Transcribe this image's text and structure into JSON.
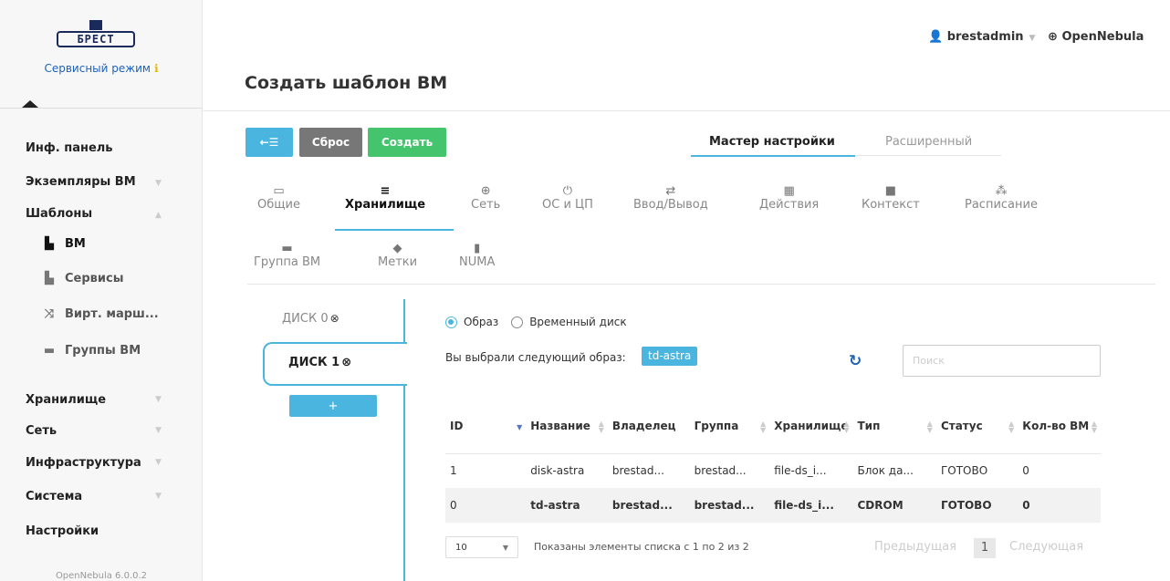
{
  "sidebar": {
    "logo_text": "БРЕСТ",
    "service_mode": "Сервисный режим",
    "menu": [
      {
        "label": "Инф. панель"
      },
      {
        "label": "Экземпляры ВМ"
      },
      {
        "label": "Шаблоны"
      },
      {
        "label": "Хранилище"
      },
      {
        "label": "Сеть"
      },
      {
        "label": "Инфраструктура"
      },
      {
        "label": "Система"
      },
      {
        "label": "Настройки"
      }
    ],
    "submenu": [
      {
        "label": "ВМ",
        "icon": "file-icon"
      },
      {
        "label": "Сервисы",
        "icon": "files-icon"
      },
      {
        "label": "Вирт. марш...",
        "icon": "random-icon"
      },
      {
        "label": "Группы ВМ",
        "icon": "folder-open-icon"
      }
    ],
    "version": "OpenNebula 6.0.0.2"
  },
  "topbar": {
    "user": "brestadmin",
    "zone": "OpenNebula"
  },
  "page": {
    "title": "Создать шаблон ВМ"
  },
  "toolbar": {
    "back_label": "←☰",
    "reset_label": "Сброс",
    "create_label": "Создать"
  },
  "modes": {
    "wizard": "Мастер настройки",
    "advanced": "Расширенный"
  },
  "wizard_tabs": [
    {
      "label": "Общие",
      "glyph": "▭"
    },
    {
      "label": "Хранилище",
      "glyph": "≡"
    },
    {
      "label": "Сеть",
      "glyph": "⊕"
    },
    {
      "label": "ОС и ЦП",
      "glyph": "⏻"
    },
    {
      "label": "Ввод/Вывод",
      "glyph": "⇄"
    },
    {
      "label": "Действия",
      "glyph": "▦"
    },
    {
      "label": "Контекст",
      "glyph": "■"
    },
    {
      "label": "Расписание",
      "glyph": "⁂"
    },
    {
      "label": "Группа ВМ",
      "glyph": "▬"
    },
    {
      "label": "Метки",
      "glyph": "◆"
    },
    {
      "label": "NUMA",
      "glyph": "▮"
    }
  ],
  "disks": {
    "disk0": "ДИСК 0",
    "disk1": "ДИСК 1",
    "add": "+"
  },
  "source": {
    "image": "Образ",
    "volatile": "Временный диск"
  },
  "selection": {
    "text": "Вы выбрали следующий образ:",
    "badge": "td-astra"
  },
  "search": {
    "placeholder": "Поиск"
  },
  "table": {
    "headers": [
      "ID",
      "Название",
      "Владелец",
      "Группа",
      "Хранилище",
      "Тип",
      "Статус",
      "Кол-во ВМ"
    ],
    "rows": [
      [
        "1",
        "disk-astra",
        "brestad...",
        "brestad...",
        "file-ds_i...",
        "Блок да...",
        "ГОТОВО",
        "0"
      ],
      [
        "0",
        "td-astra",
        "brestad...",
        "brestad...",
        "file-ds_i...",
        "CDROM",
        "ГОТОВО",
        "0"
      ]
    ]
  },
  "pagination": {
    "page_size": "10",
    "showing": "Показаны элементы списка с 1 по 2 из 2",
    "prev": "Предыдущая",
    "current": "1",
    "next": "Следующая"
  },
  "colors": {
    "accent": "#4ab6e0",
    "create": "#43c46d",
    "reset": "#777777",
    "link": "#1e61b8"
  }
}
